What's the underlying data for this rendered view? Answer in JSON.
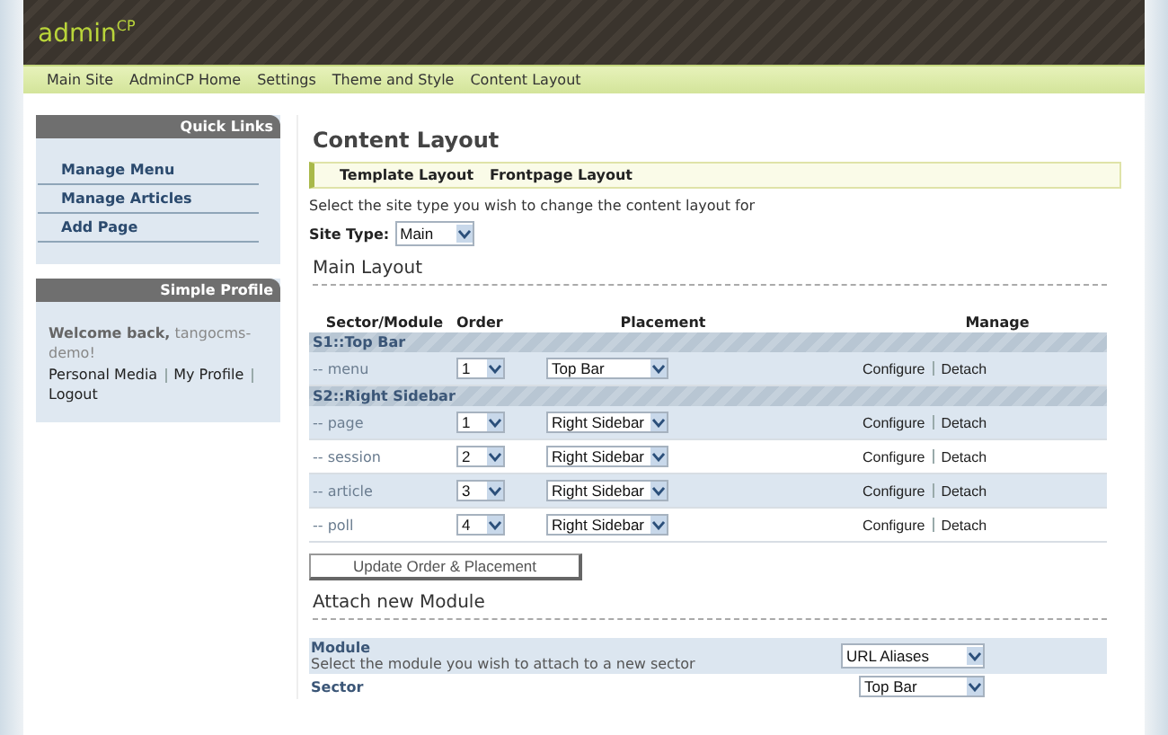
{
  "header": {
    "logo": "admin",
    "logo_sup": "CP"
  },
  "nav": {
    "items": [
      "Main Site",
      "AdminCP Home",
      "Settings",
      "Theme and Style",
      "Content Layout"
    ]
  },
  "sidebar": {
    "quick_links": {
      "title": "Quick Links",
      "items": [
        "Manage Menu",
        "Manage Articles",
        "Add Page"
      ]
    },
    "profile": {
      "title": "Simple Profile",
      "welcome": "**Welcome back,** tangocms-demo!",
      "links": [
        "Personal Media",
        "My Profile",
        "Logout"
      ]
    }
  },
  "main": {
    "title": "Content Layout",
    "subtabs": [
      "Template Layout",
      "Frontpage Layout"
    ],
    "intro": "Select the site type you wish to change the content layout for",
    "site_type": {
      "label": "Site Type:",
      "value": "Main"
    },
    "layout_heading": "Main Layout",
    "columns": [
      "Sector/Module",
      "Order",
      "Placement",
      "Manage"
    ],
    "groups": [
      {
        "name": "S1::Top Bar",
        "rows": [
          {
            "module": "-- menu",
            "order": "1",
            "placement": "Top Bar",
            "actions": [
              "Configure",
              "Detach"
            ]
          }
        ]
      },
      {
        "name": "S2::Right Sidebar",
        "rows": [
          {
            "module": "-- page",
            "order": "1",
            "placement": "Right Sidebar",
            "actions": [
              "Configure",
              "Detach"
            ]
          },
          {
            "module": "-- session",
            "order": "2",
            "placement": "Right Sidebar",
            "actions": [
              "Configure",
              "Detach"
            ]
          },
          {
            "module": "-- article",
            "order": "3",
            "placement": "Right Sidebar",
            "actions": [
              "Configure",
              "Detach"
            ]
          },
          {
            "module": "-- poll",
            "order": "4",
            "placement": "Right Sidebar",
            "actions": [
              "Configure",
              "Detach"
            ]
          }
        ]
      }
    ],
    "update_button": "Update Order & Placement",
    "attach_heading": "Attach new Module",
    "attach_rows": [
      {
        "label": "Module",
        "description": "Select the module you wish to attach to a new sector",
        "value": "URL Aliases"
      },
      {
        "label": "Sector",
        "value": "Top Bar"
      }
    ]
  }
}
